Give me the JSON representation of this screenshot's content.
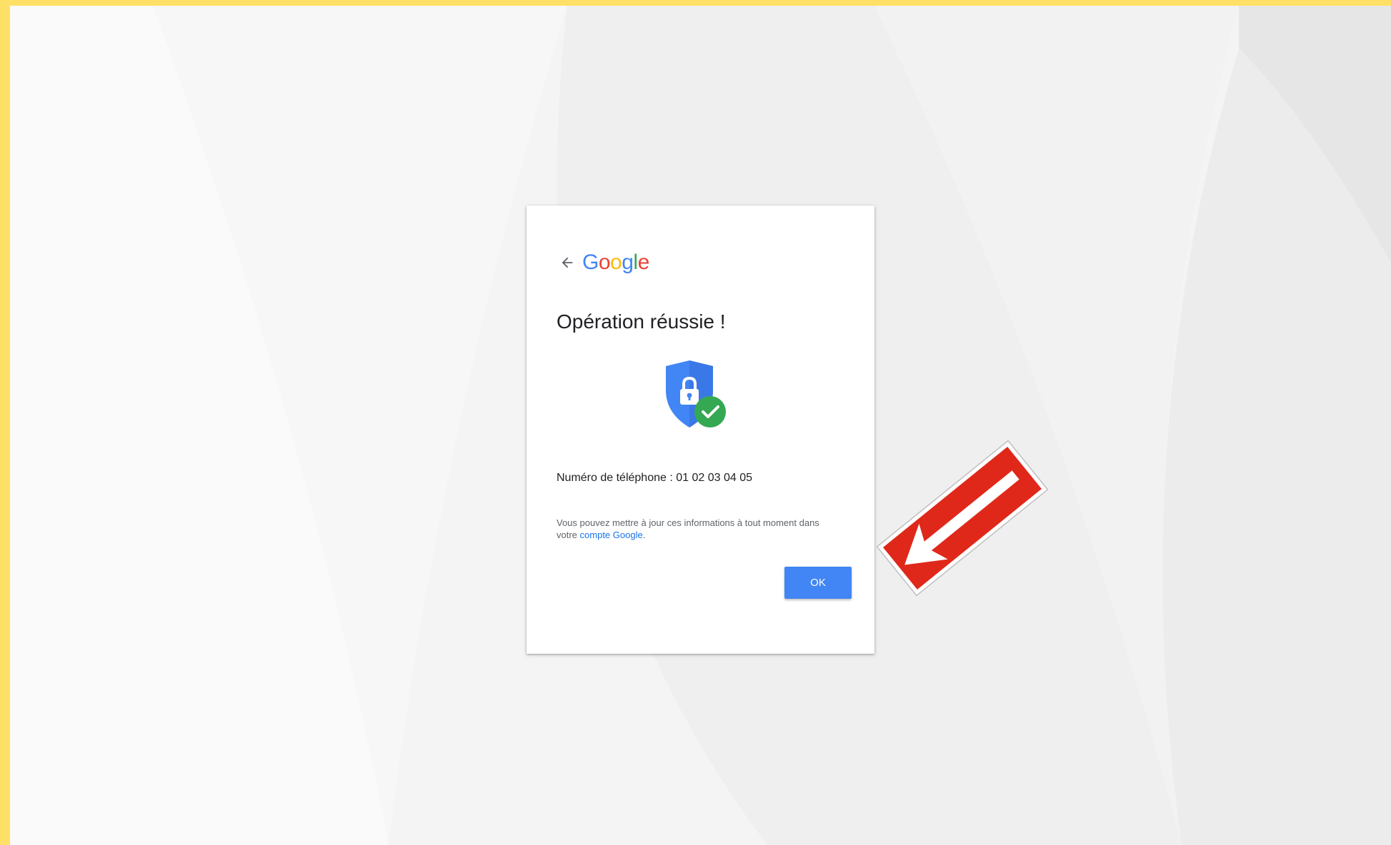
{
  "logo": {
    "letters": [
      "G",
      "o",
      "o",
      "g",
      "l",
      "e"
    ],
    "colors": [
      "#4285f4",
      "#ea4335",
      "#fbbc05",
      "#4285f4",
      "#34a853",
      "#ea4335"
    ]
  },
  "dialog": {
    "back_icon": "arrow-left-icon",
    "title": "Opération réussie !",
    "status_icon": "shield-lock-check-icon",
    "phone_label": "Numéro de téléphone :",
    "phone_value": "01 02 03 04 05",
    "info_text": "Vous pouvez mettre à jour ces informations à tout moment dans votre",
    "info_link": "compte Google",
    "info_end": ".",
    "ok_label": "OK"
  },
  "overlay": {
    "arrow_icon": "red-arrow-sign-icon"
  },
  "colors": {
    "frame": "#ffe066",
    "accent": "#4285f4",
    "success": "#34a853",
    "arrow_sign": "#e0281a"
  }
}
